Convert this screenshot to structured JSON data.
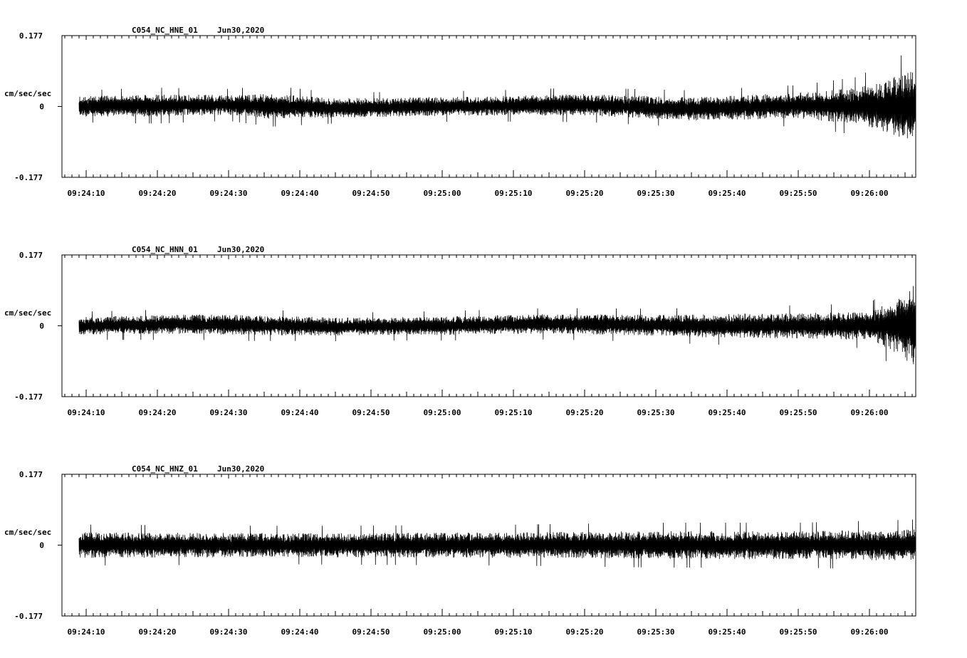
{
  "chart_data": [
    {
      "type": "line",
      "title": "C054_NC_HNE_01",
      "date": "Jun30,2020",
      "ylabel": "cm/sec/sec",
      "ylim": [
        -0.177,
        0.177
      ],
      "ytick_labels": [
        "0.177",
        "0",
        "-0.177"
      ],
      "xtick_labels": [
        "09:24:10",
        "09:24:20",
        "09:24:30",
        "09:24:40",
        "09:24:50",
        "09:25:00",
        "09:25:10",
        "09:25:20",
        "09:25:30",
        "09:25:40",
        "09:25:50",
        "09:26:00"
      ],
      "x_start_seconds": 9.0,
      "x_end_seconds": 126.0,
      "envelope": [
        [
          9,
          0.025
        ],
        [
          20,
          0.028
        ],
        [
          30,
          0.025
        ],
        [
          36,
          0.032
        ],
        [
          45,
          0.024
        ],
        [
          55,
          0.024
        ],
        [
          65,
          0.024
        ],
        [
          80,
          0.027
        ],
        [
          90,
          0.028
        ],
        [
          100,
          0.03
        ],
        [
          110,
          0.032
        ],
        [
          118,
          0.045
        ],
        [
          123,
          0.07
        ],
        [
          126,
          0.09
        ]
      ],
      "baseline_drift": [
        [
          9,
          0.0
        ],
        [
          30,
          0.004
        ],
        [
          45,
          -0.004
        ],
        [
          60,
          0.0
        ],
        [
          80,
          0.004
        ],
        [
          95,
          -0.006
        ],
        [
          110,
          0.002
        ],
        [
          126,
          0.0
        ]
      ],
      "series": [
        {
          "values": []
        }
      ]
    },
    {
      "type": "line",
      "title": "C054_NC_HNN_01",
      "date": "Jun30,2020",
      "ylabel": "cm/sec/sec",
      "ylim": [
        -0.177,
        0.177
      ],
      "ytick_labels": [
        "0.177",
        "0",
        "-0.177"
      ],
      "xtick_labels": [
        "09:24:10",
        "09:24:20",
        "09:24:30",
        "09:24:40",
        "09:24:50",
        "09:25:00",
        "09:25:10",
        "09:25:20",
        "09:25:30",
        "09:25:40",
        "09:25:50",
        "09:26:00"
      ],
      "x_start_seconds": 9.0,
      "x_end_seconds": 126.0,
      "envelope": [
        [
          9,
          0.022
        ],
        [
          30,
          0.025
        ],
        [
          50,
          0.022
        ],
        [
          70,
          0.024
        ],
        [
          90,
          0.026
        ],
        [
          100,
          0.03
        ],
        [
          110,
          0.032
        ],
        [
          120,
          0.035
        ],
        [
          124,
          0.07
        ],
        [
          126,
          0.1
        ]
      ],
      "baseline_drift": [
        [
          9,
          0.0
        ],
        [
          25,
          0.004
        ],
        [
          45,
          -0.002
        ],
        [
          60,
          0.0
        ],
        [
          75,
          0.005
        ],
        [
          95,
          0.0
        ],
        [
          115,
          0.0
        ],
        [
          126,
          0.0
        ]
      ],
      "series": [
        {
          "values": []
        }
      ]
    },
    {
      "type": "line",
      "title": "C054_NC_HNZ_01",
      "date": "Jun30,2020",
      "ylabel": "cm/sec/sec",
      "ylim": [
        -0.177,
        0.177
      ],
      "ytick_labels": [
        "0.177",
        "0",
        "-0.177"
      ],
      "xtick_labels": [
        "09:24:10",
        "09:24:20",
        "09:24:30",
        "09:24:40",
        "09:24:50",
        "09:25:00",
        "09:25:10",
        "09:25:20",
        "09:25:30",
        "09:25:40",
        "09:25:50",
        "09:26:00"
      ],
      "x_start_seconds": 9.0,
      "x_end_seconds": 126.0,
      "envelope": [
        [
          9,
          0.032
        ],
        [
          40,
          0.03
        ],
        [
          70,
          0.032
        ],
        [
          90,
          0.035
        ],
        [
          110,
          0.035
        ],
        [
          126,
          0.04
        ]
      ],
      "baseline_drift": [
        [
          9,
          0.0
        ],
        [
          126,
          0.0
        ]
      ],
      "series": [
        {
          "values": []
        }
      ]
    }
  ]
}
